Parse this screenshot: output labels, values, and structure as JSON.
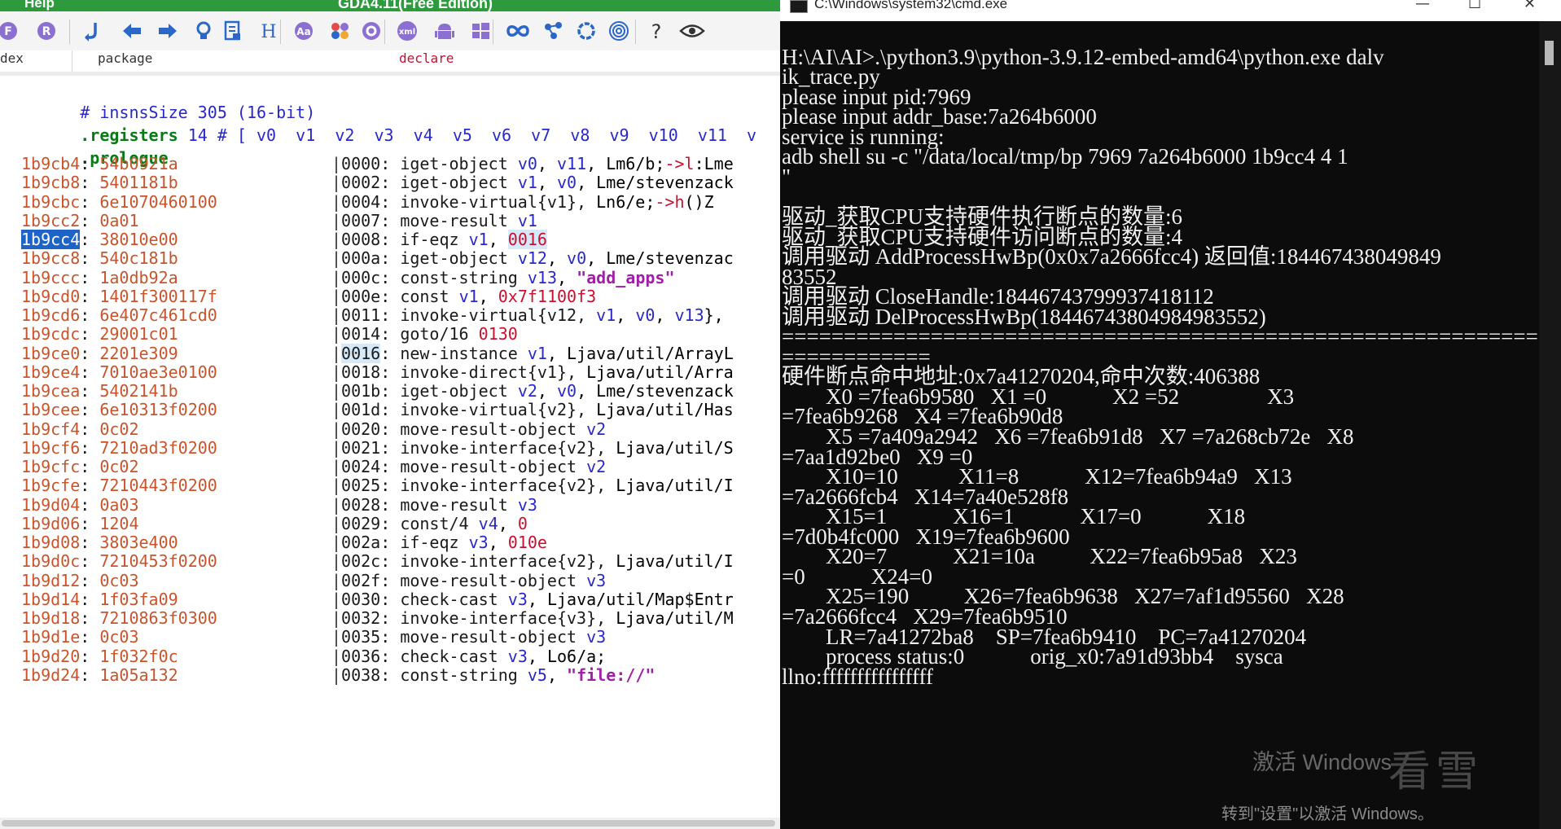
{
  "gda": {
    "menu_item": "Help",
    "title": "GDA4.11(Free Edition)",
    "columns": {
      "index": "dex",
      "package": "package",
      "declare": "declare"
    },
    "toolbar": [
      {
        "name": "back-circle-icon"
      },
      {
        "name": "r-circle-icon"
      },
      {
        "name": "jump-icon"
      },
      {
        "name": "arrow-left-icon"
      },
      {
        "name": "arrow-right-icon"
      },
      {
        "name": "lightbulb-icon"
      },
      {
        "name": "document-icon"
      },
      {
        "name": "h-icon"
      },
      {
        "name": "aa-icon"
      },
      {
        "name": "palette-icon"
      },
      {
        "name": "gear-icon"
      },
      {
        "name": "xml-icon"
      },
      {
        "name": "android-icon"
      },
      {
        "name": "windows-icon"
      },
      {
        "name": "infinity-icon"
      },
      {
        "name": "molecule-icon"
      },
      {
        "name": "sync-icon"
      },
      {
        "name": "fingerprint-icon"
      },
      {
        "name": "help-icon"
      },
      {
        "name": "eye-icon"
      }
    ],
    "header": {
      "insns_comment": "# insnsSize 305 (16-bit)",
      "registers_kw": ".registers",
      "registers_rest": " 14 # [ v0  v1  v2  v3  v4  v5  v6  v7  v8  v9  v10  v11  v",
      "prologue": ".prologue"
    },
    "lines": [
      {
        "addr": "1b9cb4",
        "hex": "54b0921a",
        "off": "0000",
        "ins": "iget-object v0, v11, Lm6/b;->l:Lme"
      },
      {
        "addr": "1b9cb8",
        "hex": "5401181b",
        "off": "0002",
        "ins": "iget-object v1, v0, Lme/stevenzack"
      },
      {
        "addr": "1b9cbc",
        "hex": "6e1070460100",
        "off": "0004",
        "ins": "invoke-virtual{v1}, Ln6/e;->h()Z"
      },
      {
        "addr": "1b9cc2",
        "hex": "0a01",
        "off": "0007",
        "ins": "move-result v1"
      },
      {
        "addr": "1b9cc4",
        "hex": "38010e00",
        "off": "0008",
        "ins": "if-eqz v1, 0016"
      },
      {
        "addr": "1b9cc8",
        "hex": "540c181b",
        "off": "000a",
        "ins": "iget-object v12, v0, Lme/stevenzac"
      },
      {
        "addr": "1b9ccc",
        "hex": "1a0db92a",
        "off": "000c",
        "ins": "const-string v13, \"add_apps\""
      },
      {
        "addr": "1b9cd0",
        "hex": "1401f300117f",
        "off": "000e",
        "ins": "const v1, 0x7f1100f3"
      },
      {
        "addr": "1b9cd6",
        "hex": "6e407c461cd0",
        "off": "0011",
        "ins": "invoke-virtual{v12, v1, v0, v13},"
      },
      {
        "addr": "1b9cdc",
        "hex": "29001c01",
        "off": "0014",
        "ins": "goto/16 0130"
      },
      {
        "addr": "1b9ce0",
        "hex": "2201e309",
        "off": "0016",
        "ins": "new-instance v1, Ljava/util/ArrayL"
      },
      {
        "addr": "1b9ce4",
        "hex": "7010ae3e0100",
        "off": "0018",
        "ins": "invoke-direct{v1}, Ljava/util/Arra"
      },
      {
        "addr": "1b9cea",
        "hex": "5402141b",
        "off": "001b",
        "ins": "iget-object v2, v0, Lme/stevenzack"
      },
      {
        "addr": "1b9cee",
        "hex": "6e10313f0200",
        "off": "001d",
        "ins": "invoke-virtual{v2}, Ljava/util/Has"
      },
      {
        "addr": "1b9cf4",
        "hex": "0c02",
        "off": "0020",
        "ins": "move-result-object v2"
      },
      {
        "addr": "1b9cf6",
        "hex": "7210ad3f0200",
        "off": "0021",
        "ins": "invoke-interface{v2}, Ljava/util/S"
      },
      {
        "addr": "1b9cfc",
        "hex": "0c02",
        "off": "0024",
        "ins": "move-result-object v2"
      },
      {
        "addr": "1b9cfe",
        "hex": "7210443f0200",
        "off": "0025",
        "ins": "invoke-interface{v2}, Ljava/util/I"
      },
      {
        "addr": "1b9d04",
        "hex": "0a03",
        "off": "0028",
        "ins": "move-result v3"
      },
      {
        "addr": "1b9d06",
        "hex": "1204",
        "off": "0029",
        "ins": "const/4 v4, 0"
      },
      {
        "addr": "1b9d08",
        "hex": "3803e400",
        "off": "002a",
        "ins": "if-eqz v3, 010e"
      },
      {
        "addr": "1b9d0c",
        "hex": "7210453f0200",
        "off": "002c",
        "ins": "invoke-interface{v2}, Ljava/util/I"
      },
      {
        "addr": "1b9d12",
        "hex": "0c03",
        "off": "002f",
        "ins": "move-result-object v3"
      },
      {
        "addr": "1b9d14",
        "hex": "1f03fa09",
        "off": "0030",
        "ins": "check-cast v3, Ljava/util/Map$Entr"
      },
      {
        "addr": "1b9d18",
        "hex": "7210863f0300",
        "off": "0032",
        "ins": "invoke-interface{v3}, Ljava/util/M"
      },
      {
        "addr": "1b9d1e",
        "hex": "0c03",
        "off": "0035",
        "ins": "move-result-object v3"
      },
      {
        "addr": "1b9d20",
        "hex": "1f032f0c",
        "off": "0036",
        "ins": "check-cast v3, Lo6/a;"
      },
      {
        "addr": "1b9d24",
        "hex": "1a05a132",
        "off": "0038",
        "ins": "const-string v5, \"file://\""
      }
    ]
  },
  "cmd": {
    "title": "C:\\Windows\\system32\\cmd.exe",
    "controls": {
      "minimize": "—",
      "maximize": "☐",
      "close": "✕"
    },
    "lines": [
      "",
      "H:\\AI\\AI>.\\python3.9\\python-3.9.12-embed-amd64\\python.exe dalv",
      "ik_trace.py",
      "please input pid:7969",
      "please input addr_base:7a264b6000",
      "service is running:",
      "adb shell su -c \"/data/local/tmp/bp 7969 7a264b6000 1b9cc4 4 1",
      "\"",
      "",
      "驱动_获取CPU支持硬件执行断点的数量:6",
      "驱动_获取CPU支持硬件访问断点的数量:4",
      "调用驱动 AddProcessHwBp(0x0x7a2666fcc4) 返回值:184467438049849",
      "83552",
      "调用驱动 CloseHandle:18446743799937418112",
      "调用驱动 DelProcessHwBp(18446743804984983552)",
      "=================================================================",
      "============",
      "硬件断点命中地址:0x7a41270204,命中次数:406388",
      "        X0 =7fea6b9580   X1 =0            X2 =52                X3",
      "=7fea6b9268   X4 =7fea6b90d8",
      "        X5 =7a409a2942   X6 =7fea6b91d8   X7 =7a268cb72e   X8",
      "=7aa1d92be0   X9 =0",
      "        X10=10           X11=8            X12=7fea6b94a9   X13",
      "=7a2666fcb4   X14=7a40e528f8",
      "        X15=1            X16=1            X17=0            X18",
      "=7d0b4fc000   X19=7fea6b9600",
      "        X20=7            X21=10a          X22=7fea6b95a8   X23",
      "=0            X24=0",
      "        X25=190          X26=7fea6b9638   X27=7af1d95560   X28",
      "=7a2666fcc4   X29=7fea6b9510",
      "        LR=7a41272ba8    SP=7fea6b9410    PC=7a41270204",
      "        process status:0            orig_x0:7a91d93bb4    sysca",
      "llno:ffffffffffffffff"
    ]
  },
  "watermark": {
    "line1": "激活 Windows",
    "line2": "转到\"设置\"以激活 Windows。",
    "site": "看雪"
  }
}
